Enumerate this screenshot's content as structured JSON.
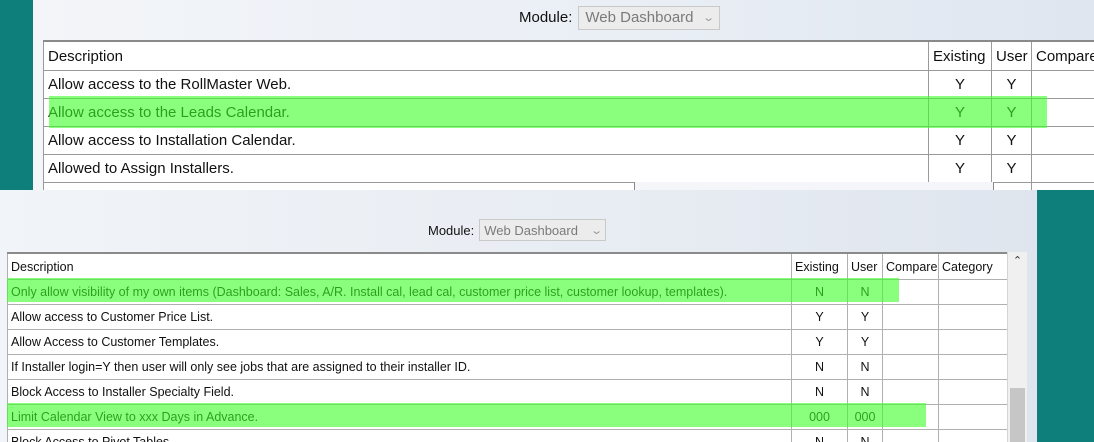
{
  "top": {
    "module_label": "Module:",
    "module_value": "Web Dashboard",
    "columns": [
      "Description",
      "Existing",
      "User",
      "Compare"
    ],
    "rows": [
      {
        "description": "Allow access to the RollMaster Web.",
        "existing": "Y",
        "user": "Y",
        "compare": ""
      },
      {
        "description": "Allow access to the Leads Calendar.",
        "existing": "Y",
        "user": "Y",
        "compare": ""
      },
      {
        "description": "Allow access to Installation Calendar.",
        "existing": "Y",
        "user": "Y",
        "compare": ""
      },
      {
        "description": "Allowed to Assign Installers.",
        "existing": "Y",
        "user": "Y",
        "compare": ""
      }
    ]
  },
  "bottom": {
    "module_label": "Module:",
    "module_value": "Web Dashboard",
    "columns": [
      "Description",
      "Existing",
      "User",
      "Compare",
      "Category"
    ],
    "rows": [
      {
        "description": "Only allow visibility of my own items (Dashboard: Sales, A/R. Install cal, lead cal, customer price list, customer lookup, templates).",
        "existing": "N",
        "user": "N",
        "compare": "",
        "category": ""
      },
      {
        "description": "Allow access to Customer Price List.",
        "existing": "Y",
        "user": "Y",
        "compare": "",
        "category": ""
      },
      {
        "description": "Allow Access to Customer Templates.",
        "existing": "Y",
        "user": "Y",
        "compare": "",
        "category": ""
      },
      {
        "description": "If Installer login=Y then user will only see jobs that are assigned to their installer ID.",
        "existing": "N",
        "user": "N",
        "compare": "",
        "category": ""
      },
      {
        "description": "Block Access to Installer Specialty Field.",
        "existing": "N",
        "user": "N",
        "compare": "",
        "category": ""
      },
      {
        "description": "Limit Calendar View to xxx Days in Advance.",
        "existing": "000",
        "user": "000",
        "compare": "",
        "category": ""
      },
      {
        "description": "Block Access to Pivot Tables",
        "existing": "N",
        "user": "N",
        "compare": "",
        "category": ""
      }
    ]
  },
  "icons": {
    "dropdown": "chevron-down-icon",
    "scroll_up": "scroll-up-arrow-icon"
  },
  "colors": {
    "highlight": "#3cff28",
    "accent_teal": "#0e7f7a"
  }
}
